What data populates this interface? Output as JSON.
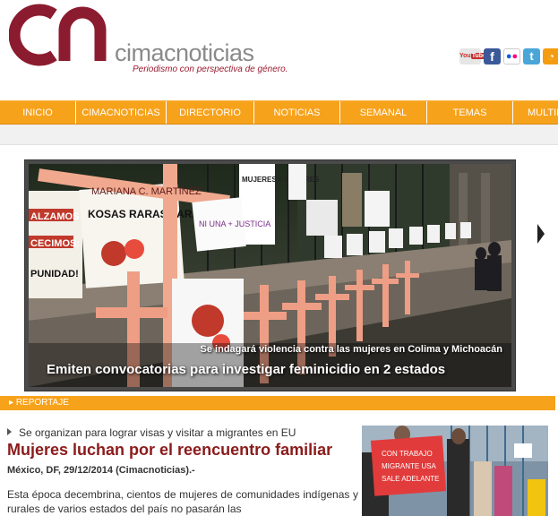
{
  "header": {
    "logo_mark": "cn",
    "site_name": "cimacnoticias",
    "tagline": "Periodismo con perspectiva de género."
  },
  "social": [
    {
      "name": "youtube-icon",
      "label": "YouTube",
      "color": "#e7e7e7"
    },
    {
      "name": "facebook-icon",
      "label": "f",
      "color": "#3b5998"
    },
    {
      "name": "flickr-icon",
      "label": "●●",
      "color": "#ffffff"
    },
    {
      "name": "twitter-icon",
      "label": "t",
      "color": "#4aa6d8"
    },
    {
      "name": "rss-icon",
      "label": "◔",
      "color": "#f39c12"
    }
  ],
  "nav": {
    "items": [
      "INICIO",
      "CIMACNOTICIAS",
      "DIRECTORIO",
      "NOTICIAS",
      "SEMANAL",
      "TEMAS",
      "MULTIM"
    ]
  },
  "slider": {
    "subtitle": "Se indagará violencia contra las mujeres en Colima y Michoacán",
    "title": "Emiten convocatorias para investigar feminicidio en 2 estados",
    "photo_signs": [
      "MARIANA C. MARTÍNEZ",
      "KOSAS RARAS PARA DETEN",
      "ALZAMOS",
      "CECIMOS:",
      "PUNIDAD!",
      "MUJERES + MUJERES",
      "NI UNA + JUSTICIA",
      "NI UNA"
    ]
  },
  "section": {
    "label": "REPORTAJE"
  },
  "article": {
    "kicker": "Se organizan para lograr visas y visitar a migrantes en EU",
    "headline": "Mujeres luchan por el reencuentro familiar",
    "dateline": "México, DF, 29/12/2014 (Cimacnoticias).-",
    "body": "Esta época decembrina, cientos de mujeres de comunidades indígenas y rurales de varios estados del país no pasarán las",
    "thumb_sign": [
      "CON TRABAJO",
      "MIGRANTE USA",
      "SALE ADELANTE"
    ]
  },
  "colors": {
    "brand": "#8b1b2e",
    "nav": "#f7a21b",
    "headline": "#8b1b1b"
  }
}
